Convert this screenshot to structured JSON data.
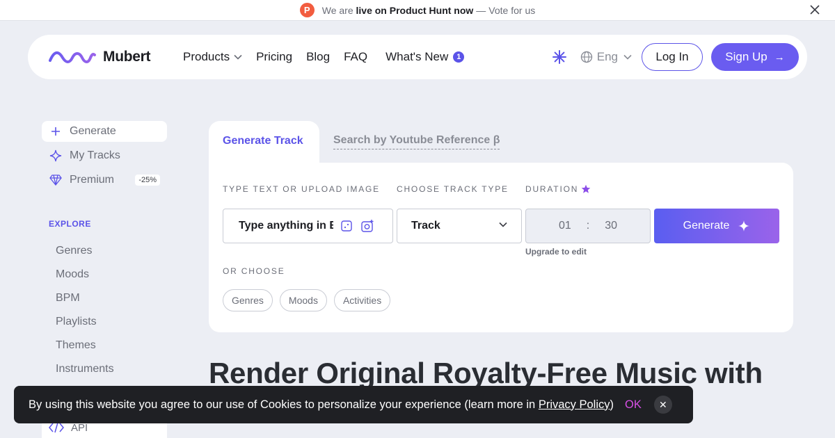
{
  "announcement": {
    "badge": "P",
    "prefix": "We are",
    "highlight": "live on Product Hunt now",
    "separator": "—",
    "suffix": "Vote for us",
    "close_icon": "close-icon"
  },
  "nav": {
    "logo_text": "Mubert",
    "links": {
      "products": "Products",
      "pricing": "Pricing",
      "blog": "Blog",
      "faq": "FAQ",
      "whats_new": "What's New",
      "whats_new_badge": "1"
    },
    "language": "Eng",
    "login": "Log In",
    "signup": "Sign Up",
    "signup_arrow": "→"
  },
  "sidebar": {
    "items": [
      {
        "label": "Generate",
        "icon": "plus-icon"
      },
      {
        "label": "My Tracks",
        "icon": "sparkle-icon"
      },
      {
        "label": "Premium",
        "icon": "diamond-icon",
        "discount": "-25%"
      }
    ],
    "explore_label": "EXPLORE",
    "explore": [
      "Genres",
      "Moods",
      "BPM",
      "Playlists",
      "Themes",
      "Instruments"
    ],
    "api_label": "API"
  },
  "tabs": {
    "active": "Generate Track",
    "inactive": "Search by Youtube Reference β"
  },
  "form": {
    "text_label": "TYPE TEXT OR UPLOAD IMAGE",
    "type_label": "CHOOSE TRACK TYPE",
    "duration_label": "DURATION",
    "text_placeholder": "Type anything in English",
    "track_type": "Track",
    "duration_min": "01",
    "duration_sep": ":",
    "duration_sec": "30",
    "upgrade_note": "Upgrade to edit",
    "generate": "Generate",
    "or_choose": "OR CHOOSE",
    "chips": [
      "Genres",
      "Moods",
      "Activities"
    ]
  },
  "hero": {
    "title": "Render Original Royalty-Free Music with"
  },
  "cookie": {
    "text": "By using this website you agree to our use of Cookies to personalize your experience (learn more in",
    "link": "Privacy Policy",
    "close_paren": ")",
    "ok": "OK",
    "close": "✕"
  },
  "colors": {
    "accent": "#5b53e8",
    "signup_bg": "#6a5cf0",
    "page_bg": "#eceef4",
    "cookie_bg": "#1f2024",
    "ok": "#d850e6",
    "product_hunt": "#f25c3f"
  }
}
